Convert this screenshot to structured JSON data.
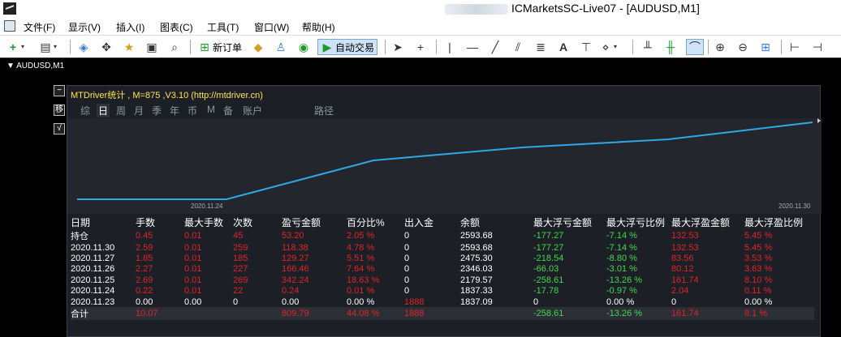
{
  "window": {
    "title": "ICMarketsSC-Live07 - [AUDUSD,M1]"
  },
  "menu": [
    "文件(F)",
    "显示(V)",
    "插入(I)",
    "图表(C)",
    "工具(T)",
    "窗口(W)",
    "帮助(H)"
  ],
  "toolbar": {
    "new_order": "新订单",
    "auto_trading": "自动交易"
  },
  "chart": {
    "symbol": "AUDUSD,M1"
  },
  "panel": {
    "title": "MTDriver统计 , M=875 ,V3.10 (http://mtdriver.cn)",
    "side_buttons": [
      "−",
      "移",
      "√"
    ],
    "tabs": [
      "综",
      "日",
      "周",
      "月",
      "季",
      "年",
      "币",
      "M",
      "备",
      "账户",
      "路径"
    ],
    "selected_tab": "日",
    "chart_start_label": "2020.11.24",
    "chart_end_label": "2020.11.30"
  },
  "table": {
    "headers": [
      "日期",
      "手数",
      "最大手数",
      "次数",
      "盈亏金额",
      "百分比%",
      "出入金",
      "余额",
      "最大浮亏金额",
      "最大浮亏比例",
      "最大浮盈金额",
      "最大浮盈比例"
    ],
    "rows": [
      [
        "持仓",
        "0.45",
        "0.01",
        "45",
        "53.20",
        "2.05 %",
        "0",
        "2593.68",
        "-177.27",
        "-7.14 %",
        "132.53",
        "5.45 %"
      ],
      [
        "2020.11.30",
        "2.59",
        "0.01",
        "259",
        "118.38",
        "4.78 %",
        "0",
        "2593.68",
        "-177.27",
        "-7.14 %",
        "132.53",
        "5.45 %"
      ],
      [
        "2020.11.27",
        "1.85",
        "0.01",
        "185",
        "129.27",
        "5.51 %",
        "0",
        "2475.30",
        "-218.54",
        "-8.80 %",
        "83.56",
        "3.53 %"
      ],
      [
        "2020.11.26",
        "2.27",
        "0.01",
        "227",
        "166.46",
        "7.64 %",
        "0",
        "2346.03",
        "-66.03",
        "-3.01 %",
        "80.12",
        "3.63 %"
      ],
      [
        "2020.11.25",
        "2.69",
        "0.01",
        "269",
        "342.24",
        "18.63 %",
        "0",
        "2179.57",
        "-258.61",
        "-13.26 %",
        "161.74",
        "8.10 %"
      ],
      [
        "2020.11.24",
        "0.22",
        "0.01",
        "22",
        "0.24",
        "0.01 %",
        "0",
        "1837.33",
        "-17.78",
        "-0.97 %",
        "2.04",
        "0.11 %"
      ],
      [
        "2020.11.23",
        "0.00",
        "0.00",
        "0",
        "0.00",
        "0.00 %",
        "1888",
        "1837.09",
        "0",
        "0.00 %",
        "0",
        "0.00 %"
      ]
    ],
    "total": [
      "合计",
      "10.07",
      "",
      "",
      "809.79",
      "44.08 %",
      "1888",
      "",
      "-258.61",
      "-13.26 %",
      "161.74",
      "8.1 %"
    ]
  },
  "colors": {
    "positive": "#e0242a",
    "negative": "#3fd84d",
    "line": "#2ea8e6",
    "panel_bg": "#1c2026"
  }
}
